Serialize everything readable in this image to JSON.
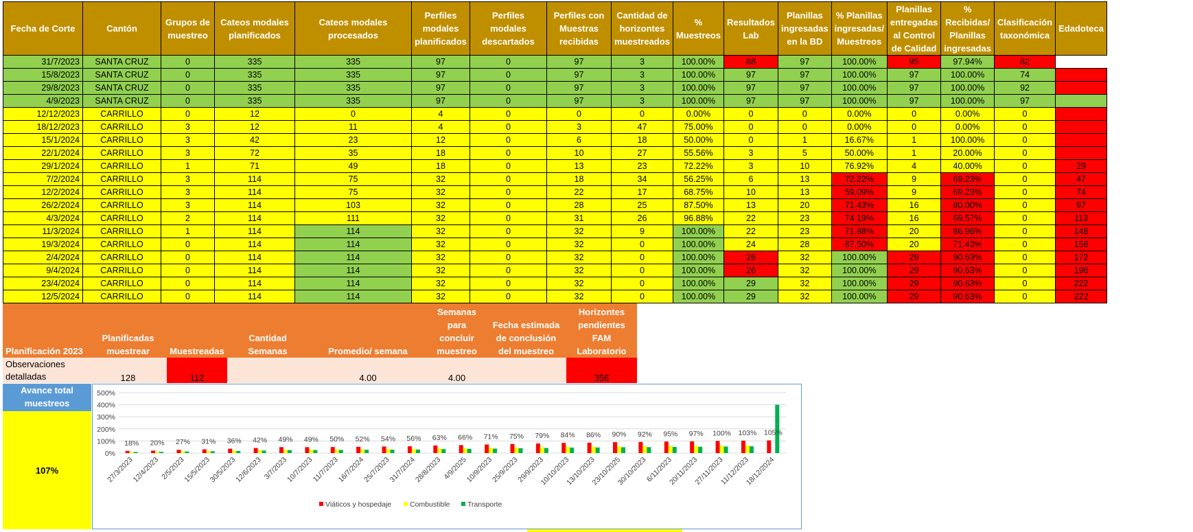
{
  "main_table": {
    "headers": [
      "Fecha de Corte",
      "Cantón",
      "Grupos de muestreo",
      "Cateos modales planificados",
      "Cateos modales procesados",
      "Perfiles modales planificados",
      "Perfiles modales descartados",
      "Perfiles con Muestras recibidas",
      "Cantidad de horizontes muestreados",
      "% Muestreos",
      "Resultados Lab",
      "Planillas ingresadas en la BD",
      "% Planillas ingresadas/ Muestreos",
      "Planillas entregadas al Control de Calidad",
      "% Recibidas/ Planillas ingresadas",
      "Clasificación taxonómica",
      "Edadoteca"
    ],
    "colors": {
      "green": "#92d050",
      "yellow": "#ffff00",
      "red": "#ff0000",
      "header": "#bf8f00"
    },
    "rows": [
      {
        "cells": [
          "31/7/2023",
          "SANTA CRUZ",
          "0",
          "335",
          "335",
          "97",
          "0",
          "97",
          "3",
          "100.00%",
          "88",
          "97",
          "100.00%",
          "95",
          "97.94%",
          "62",
          ""
        ],
        "colors": "gggggggggg rggrgrw"
      },
      {
        "cells": [
          "15/8/2023",
          "SANTA CRUZ",
          "0",
          "335",
          "335",
          "97",
          "0",
          "97",
          "3",
          "100.00%",
          "97",
          "97",
          "100.00%",
          "97",
          "100.00%",
          "74",
          ""
        ],
        "colors": "ggggggggggggggggrw"
      },
      {
        "cells": [
          "29/8/2023",
          "SANTA CRUZ",
          "0",
          "335",
          "335",
          "97",
          "0",
          "97",
          "3",
          "100.00%",
          "97",
          "97",
          "100.00%",
          "97",
          "100.00%",
          "92",
          ""
        ],
        "colors": "ggggggggggggggggrw"
      },
      {
        "cells": [
          "4/9/2023",
          "SANTA CRUZ",
          "0",
          "335",
          "335",
          "97",
          "0",
          "97",
          "3",
          "100.00%",
          "97",
          "97",
          "100.00%",
          "97",
          "100.00%",
          "97",
          ""
        ],
        "colors": "gggggggggggggggggw"
      },
      {
        "cells": [
          "12/12/2023",
          "CARRILLO",
          "0",
          "12",
          "0",
          "4",
          "0",
          "0",
          "0",
          "0.00%",
          "0",
          "0",
          "0.00%",
          "0",
          "0.00%",
          "0",
          ""
        ],
        "colors": "yyyyyyyyyyyyyyyyrw"
      },
      {
        "cells": [
          "18/12/2023",
          "CARRILLO",
          "3",
          "12",
          "11",
          "4",
          "0",
          "3",
          "47",
          "75.00%",
          "0",
          "0",
          "0.00%",
          "0",
          "0.00%",
          "0",
          ""
        ],
        "colors": "yyyyyyyyyyyyyyyyrw"
      },
      {
        "cells": [
          "15/1/2024",
          "CARRILLO",
          "3",
          "42",
          "23",
          "12",
          "0",
          "6",
          "18",
          "50.00%",
          "0",
          "1",
          "16.67%",
          "1",
          "100.00%",
          "0",
          ""
        ],
        "colors": "yyyyyyyyyyyyyyyyrw"
      },
      {
        "cells": [
          "22/1/2024",
          "CARRILLO",
          "3",
          "72",
          "35",
          "18",
          "0",
          "10",
          "27",
          "55.56%",
          "3",
          "5",
          "50.00%",
          "1",
          "20.00%",
          "0",
          ""
        ],
        "colors": "yyyyyyyyyyyyyyyyrw"
      },
      {
        "cells": [
          "29/1/2024",
          "CARRILLO",
          "1",
          "71",
          "49",
          "18",
          "0",
          "13",
          "23",
          "72.22%",
          "3",
          "10",
          "76.92%",
          "4",
          "40.00%",
          "0",
          "29"
        ],
        "colors": "yyyyyyyyyyyyyyyyry"
      },
      {
        "cells": [
          "7/2/2024",
          "CARRILLO",
          "3",
          "114",
          "75",
          "32",
          "0",
          "18",
          "34",
          "56.25%",
          "6",
          "13",
          "72.22%",
          "9",
          "69.23%",
          "0",
          "47"
        ],
        "colors": "yyyyyyyyyyyyryryry"
      },
      {
        "cells": [
          "12/2/2024",
          "CARRILLO",
          "3",
          "114",
          "75",
          "32",
          "0",
          "22",
          "17",
          "68.75%",
          "10",
          "13",
          "59.09%",
          "9",
          "69.23%",
          "0",
          "74"
        ],
        "colors": "yyyyyyyyyyyyryryry"
      },
      {
        "cells": [
          "26/2/2024",
          "CARRILLO",
          "3",
          "114",
          "103",
          "32",
          "0",
          "28",
          "25",
          "87.50%",
          "13",
          "20",
          "71.43%",
          "16",
          "80.00%",
          "0",
          "97"
        ],
        "colors": "yyyyyyyyyyyyryryry"
      },
      {
        "cells": [
          "4/3/2024",
          "CARRILLO",
          "2",
          "114",
          "111",
          "32",
          "0",
          "31",
          "26",
          "96.88%",
          "22",
          "23",
          "74.19%",
          "16",
          "69.57%",
          "0",
          "113"
        ],
        "colors": "yyyyyyyyyyyyryryry"
      },
      {
        "cells": [
          "11/3/2024",
          "CARRILLO",
          "1",
          "114",
          "114",
          "32",
          "0",
          "32",
          "9",
          "100.00%",
          "22",
          "23",
          "71.88%",
          "20",
          "86.96%",
          "0",
          "148"
        ],
        "colors": "yyyygyyyygyyryryry"
      },
      {
        "cells": [
          "19/3/2024",
          "CARRILLO",
          "0",
          "114",
          "114",
          "32",
          "0",
          "32",
          "0",
          "100.00%",
          "24",
          "28",
          "87.50%",
          "20",
          "71.43%",
          "0",
          "156"
        ],
        "colors": "yyyygyyyygyyryryry"
      },
      {
        "cells": [
          "2/4/2024",
          "CARRILLO",
          "0",
          "114",
          "114",
          "32",
          "0",
          "32",
          "0",
          "100.00%",
          "26",
          "32",
          "100.00%",
          "29",
          "90.63%",
          "0",
          "172"
        ],
        "colors": "yyyygyyyygrygrryry"
      },
      {
        "cells": [
          "9/4/2024",
          "CARRILLO",
          "0",
          "114",
          "114",
          "32",
          "0",
          "32",
          "0",
          "100.00%",
          "26",
          "32",
          "100.00%",
          "29",
          "90.63%",
          "0",
          "196"
        ],
        "colors": "yyyygyyyygrygrryry"
      },
      {
        "cells": [
          "23/4/2024",
          "CARRILLO",
          "0",
          "114",
          "114",
          "32",
          "0",
          "32",
          "0",
          "100.00%",
          "29",
          "32",
          "100.00%",
          "29",
          "90.63%",
          "0",
          "222"
        ],
        "colors": "yyyygyyyyggygrryry"
      },
      {
        "cells": [
          "12/5/2024",
          "CARRILLO",
          "0",
          "114",
          "114",
          "32",
          "0",
          "32",
          "0",
          "100.00%",
          "29",
          "32",
          "100.00%",
          "29",
          "90.63%",
          "0",
          "222"
        ],
        "colors": "yyyygyyyyggygrryry"
      }
    ]
  },
  "planning": {
    "headers": [
      "Planificación 2023",
      "Planificadas muestrear",
      "Muestreadas",
      "Cantidad Semanas",
      "Promedio/ semana",
      "Semanas para concluir muestreo",
      "Fecha estimada de conclusión del muestreo",
      "Horizontes pendientes FAM Laboratorio"
    ],
    "values": [
      "Observaciones detalladas",
      "128",
      "112",
      "",
      "4.00",
      "4.00",
      "",
      "356"
    ]
  },
  "avance": {
    "title": "Avance total muestreos",
    "value": "107%"
  },
  "chart_data": {
    "type": "bar",
    "categories": [
      "27/3/2023",
      "12/4/2023",
      "2/5/2023",
      "15/5/2023",
      "30/5/2023",
      "12/6/2023",
      "3/7/2023",
      "10/7/2023",
      "11/7/2023",
      "16/7/2024",
      "25/7/2023",
      "31/7/2024",
      "28/8/2023",
      "4/9/2025",
      "10/9/2023",
      "25/9/2023",
      "29/9/2023",
      "10/10/2023",
      "13/10/2023",
      "23/10/2025",
      "30/10/2023",
      "6/11/2023",
      "20/11/2023",
      "27/11/2023",
      "11/12/2023",
      "18/12/2024"
    ],
    "labels": [
      "18%",
      "20%",
      "27%",
      "31%",
      "36%",
      "42%",
      "49%",
      "49%",
      "50%",
      "52%",
      "54%",
      "56%",
      "63%",
      "66%",
      "71%",
      "75%",
      "79%",
      "84%",
      "86%",
      "90%",
      "92%",
      "95%",
      "97%",
      "100%",
      "103%",
      "105%"
    ],
    "series": [
      {
        "name": "Viáticos y hospedaje",
        "color": "#ff0000",
        "values": [
          18,
          20,
          27,
          31,
          36,
          42,
          49,
          49,
          50,
          52,
          54,
          56,
          63,
          66,
          71,
          75,
          79,
          84,
          86,
          90,
          92,
          95,
          97,
          100,
          103,
          105
        ]
      },
      {
        "name": "Combustible",
        "color": "#ffff00",
        "values": [
          10,
          12,
          15,
          17,
          20,
          24,
          28,
          29,
          30,
          31,
          32,
          33,
          38,
          40,
          43,
          46,
          49,
          52,
          53,
          56,
          57,
          59,
          60,
          62,
          64,
          0
        ]
      },
      {
        "name": "Transporte",
        "color": "#00b050",
        "values": [
          9,
          10,
          13,
          15,
          17,
          21,
          25,
          25,
          26,
          27,
          28,
          29,
          33,
          35,
          37,
          40,
          42,
          45,
          46,
          48,
          49,
          51,
          52,
          54,
          56,
          400
        ]
      }
    ],
    "yticks": [
      "0%",
      "100%",
      "200%",
      "300%",
      "400%",
      "500%"
    ],
    "ylim": [
      0,
      500
    ],
    "legend_position": "bottom"
  }
}
